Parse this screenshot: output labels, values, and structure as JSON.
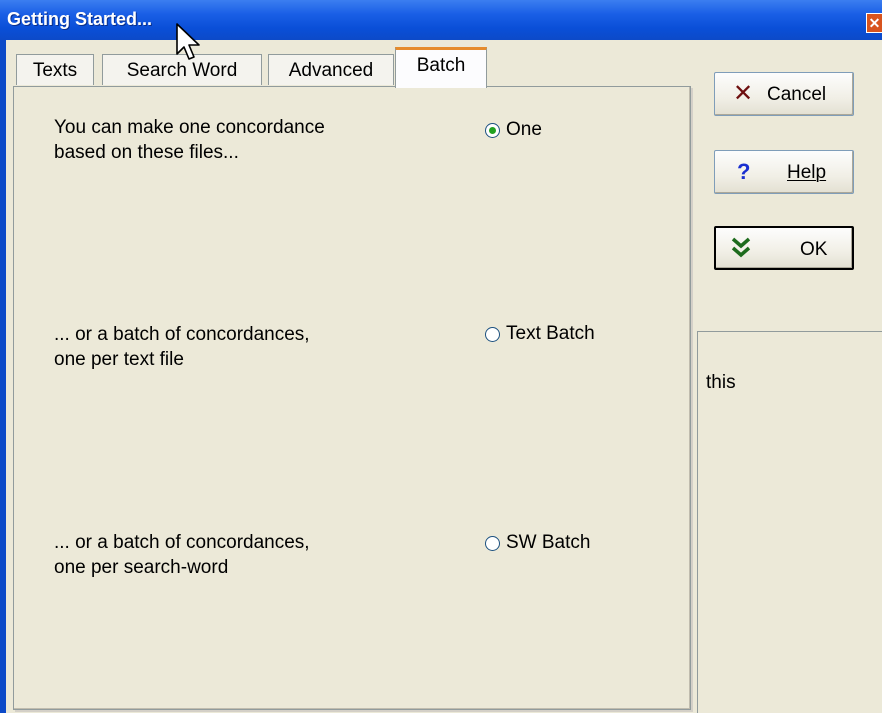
{
  "window": {
    "title": "Getting Started...",
    "close_icon": "close-icon"
  },
  "tabs": [
    {
      "label": "Texts",
      "active": false
    },
    {
      "label": "Search Word",
      "active": false
    },
    {
      "label": "Advanced",
      "active": false
    },
    {
      "label": "Batch",
      "active": true
    }
  ],
  "batch": {
    "options": [
      {
        "line1": "You can make one concordance",
        "line2": "based on these files...",
        "radio_label": "One",
        "selected": true
      },
      {
        "line1": "... or a batch of concordances,",
        "line2": "one per text file",
        "radio_label": "Text Batch",
        "selected": false
      },
      {
        "line1": "... or a batch of concordances,",
        "line2": "one per search-word",
        "radio_label": "SW Batch",
        "selected": false
      }
    ]
  },
  "buttons": {
    "cancel": {
      "label": "Cancel",
      "icon": "cancel-x-icon",
      "color": "#6e0f0f"
    },
    "help": {
      "label": "Help",
      "icon": "question-icon",
      "color": "#1a2fd0"
    },
    "ok": {
      "label": "OK",
      "icon": "double-check-icon",
      "color": "#1d6b1d"
    }
  },
  "side_panel": {
    "text": "this"
  }
}
